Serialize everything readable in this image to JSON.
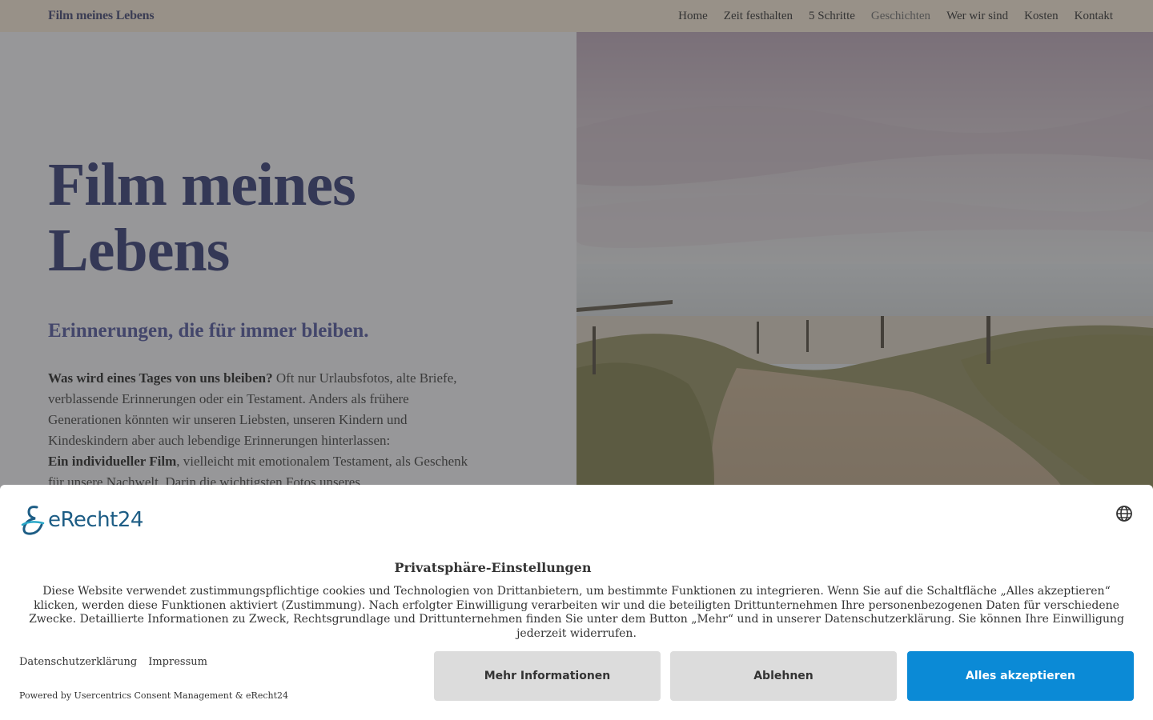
{
  "nav": {
    "brand": "Film meines Lebens",
    "items": [
      "Home",
      "Zeit festhalten",
      "5 Schritte",
      "Geschichten",
      "Wer wir sind",
      "Kosten",
      "Kontakt"
    ]
  },
  "hero": {
    "title": "Film meines Lebens",
    "subtitle": "Erinnerungen, die für immer bleiben.",
    "text_bold1": "Was wird eines Tages von uns bleiben?",
    "text1": " Oft nur Urlaubsfotos, alte Briefe, verblassende Erinnerungen oder ein Testament. Anders als frühere Generationen könnten wir unseren Liebsten, unseren Kindern und Kindeskindern aber auch lebendige Erinnerungen hinterlassen:",
    "text_bold2": "Ein individueller Film",
    "text2": ", vielleicht mit emotionalem Testament, als Geschenk für unsere Nachwelt. Darin die wichtigsten Fotos unseres"
  },
  "consent": {
    "logo_text": "eRecht24",
    "title": "Privatsphäre-Einstellungen",
    "text": "Diese Website verwendet zustimmungspflichtige cookies und Technologien von Drittanbietern, um bestimmte Funktionen zu integrieren. Wenn Sie auf die Schaltfläche „Alles akzeptieren“ klicken, werden diese Funktionen aktiviert (Zustimmung). Nach erfolgter Einwilligung verarbeiten wir und die beteiligten Drittunternehmen Ihre personenbezogenen Daten für verschiedene Zwecke. Detaillierte Informationen zu Zweck, Rechtsgrundlage und Drittunternehmen finden Sie unter dem Button „Mehr“ und in unserer Datenschutzerklärung. Sie können Ihre Einwilligung jederzeit widerrufen.",
    "link_privacy": "Datenschutzerklärung",
    "link_imprint": "Impressum",
    "powered": "Powered by Usercentrics Consent Management & eRecht24",
    "btn_more": "Mehr Informationen",
    "btn_deny": "Ablehnen",
    "btn_accept": "Alles akzeptieren",
    "accent_color": "#0b8ad6"
  }
}
